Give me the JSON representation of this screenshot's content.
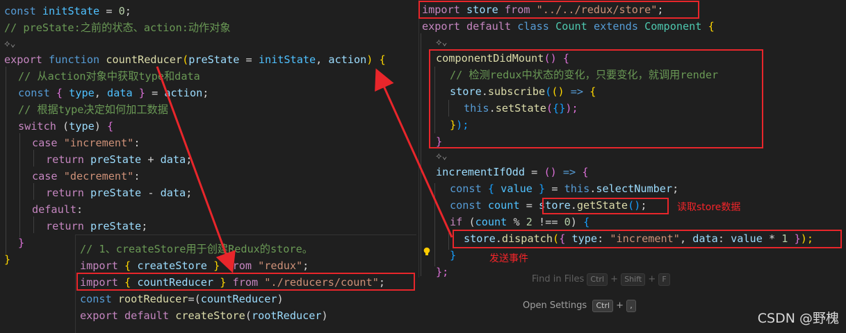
{
  "left_code": {
    "l1": {
      "a": "const",
      "b": "initState",
      "c": " = ",
      "d": "0",
      "e": ";"
    },
    "l2": {
      "text": "// preState:之前的状态、action:动作对象"
    },
    "l3": {
      "icon": "codelens-icon"
    },
    "l4": {
      "a": "export",
      "b": "function",
      "c": "countReducer",
      "d": "(",
      "e": "preState",
      "f": " = ",
      "g": "initState",
      "h": ", ",
      "i": "action",
      "j": ") ",
      "k": "{"
    },
    "l5": {
      "text": "// 从action对象中获取type和data"
    },
    "l6": {
      "a": "const",
      "b": "{",
      "c": " type",
      "d": ", ",
      "e": "data",
      "f": "}",
      "g": " = ",
      "h": "action",
      "i": ";"
    },
    "l7": {
      "text": "// 根据type决定如何加工数据"
    },
    "l8": {
      "a": "switch",
      "b": " (",
      "c": "type",
      "d": ") ",
      "e": "{"
    },
    "l9": {
      "a": "case",
      "b": "\"increment\"",
      "c": ":"
    },
    "l10": {
      "a": "return",
      "b": "preState",
      "c": " + ",
      "d": "data",
      "e": ";"
    },
    "l11": {
      "a": "case",
      "b": "\"decrement\"",
      "c": ":"
    },
    "l12": {
      "a": "return",
      "b": "preState",
      "c": " - ",
      "d": "data",
      "e": ";"
    },
    "l13": {
      "a": "default",
      "b": ":"
    },
    "l14": {
      "a": "return",
      "b": "preState",
      "c": ";"
    },
    "l15": {
      "a": "}"
    },
    "l16": {
      "a": "}"
    }
  },
  "bottom_code": {
    "l1": {
      "text": "// 1、createStore用于创建Redux的store。"
    },
    "l2": {
      "a": "import",
      "b": "{",
      "c": "createStore",
      "d": "}",
      "e": "from",
      "f": "\"redux\"",
      "g": ";"
    },
    "l3": {
      "a": "import",
      "b": "{",
      "c": "countReducer",
      "d": "}",
      "e": "from",
      "f": "\"./reducers/count\"",
      "g": ";"
    },
    "l4": {
      "a": "const",
      "b": "rootReducer",
      "c": "=(",
      "d": "countReducer",
      "e": ")"
    },
    "l5": {
      "a": "export",
      "b": "default",
      "c": "createStore",
      "d": "(",
      "e": "rootReducer",
      "f": ")"
    }
  },
  "right_code": {
    "l1": {
      "a": "import",
      "b": "store",
      "c": "from",
      "d": "\"../../redux/store\"",
      "e": ";"
    },
    "l2": {
      "a": "export",
      "b": "default",
      "c": "class",
      "d": "Count",
      "e": "extends",
      "f": "Component",
      "g": "{"
    },
    "l3": {
      "icon": "codelens-icon"
    },
    "l4": {
      "a": "componentDidMount",
      "b": "() ",
      "c": "{"
    },
    "l5": {
      "text": "// 检测redux中状态的变化，只要变化，就调用render"
    },
    "l6": {
      "a": "store",
      "b": ".",
      "c": "subscribe",
      "d": "(",
      "e": "() ",
      "f": "=>",
      "g": " {"
    },
    "l7": {
      "a": "this",
      "b": ".",
      "c": "setState",
      "d": "(",
      "e": "{}",
      "f": ");"
    },
    "l8": {
      "a": "}",
      "b": ");"
    },
    "l9": {
      "a": "}"
    },
    "l10": {
      "icon": "codelens-icon"
    },
    "l11": {
      "a": "incrementIfOdd",
      "b": " = ",
      "c": "() ",
      "d": "=>",
      "e": " {"
    },
    "l12": {
      "a": "const",
      "b": "{",
      "c": " value ",
      "d": "}",
      "e": " = ",
      "f": "this",
      "g": ".",
      "h": "selectNumber",
      "i": ";"
    },
    "l13": {
      "a": "const",
      "b": "count",
      "c": " = ",
      "d": "store",
      "e": ".",
      "f": "getState",
      "g": "()",
      "h": ";"
    },
    "l14": {
      "a": "if",
      "b": " (",
      "c": "count",
      "d": " % ",
      "e": "2",
      "f": " !== ",
      "g": "0",
      "h": ") ",
      "i": "{"
    },
    "l15": {
      "a": "store",
      "b": ".",
      "c": "dispatch",
      "d": "(",
      "e": "{",
      "f": " type",
      "g": ": ",
      "h": "\"increment\"",
      "i": ", ",
      "j": "data",
      "k": ": ",
      "l": "value",
      "m": " * ",
      "n": "1",
      "o": " }",
      "p": ");"
    },
    "l16": {
      "a": "}"
    },
    "l17": {
      "a": "};"
    }
  },
  "annotations": {
    "read_store": "读取store数据",
    "send_event": "发送事件"
  },
  "overlay": {
    "find_in_files": "Find in Files",
    "ctrl": "Ctrl",
    "shift": "Shift",
    "f": "F",
    "open_settings": "Open Settings",
    "plus": "+",
    "comma": ","
  },
  "watermark": "CSDN @野槐",
  "colors": {
    "annotation_red": "#e8262b",
    "editor_bg": "#1f1f1f"
  }
}
